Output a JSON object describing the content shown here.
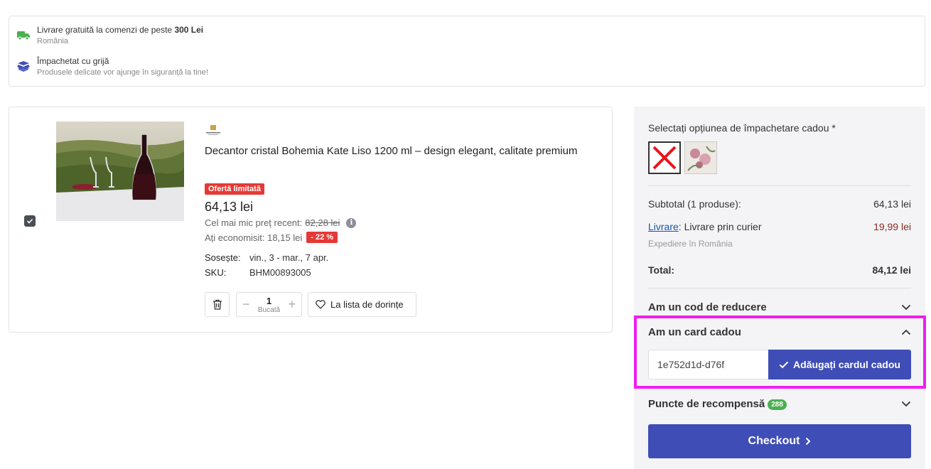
{
  "info": {
    "shipping_title_prefix": "Livrare gratuită la comenzi de peste ",
    "shipping_title_bold": "300 Lei",
    "shipping_sub": "România",
    "packing_title": "Împachetat cu grijă",
    "packing_sub": "Produsele delicate vor ajunge în siguranță la tine!"
  },
  "product": {
    "title": "Decantor cristal Bohemia Kate Liso 1200 ml – design elegant, calitate premium",
    "offer_badge": "Ofertă limitată",
    "price": "64,13 lei",
    "low_price_label": "Cel mai mic preț recent:",
    "low_price_value": "82,28 lei",
    "info_glyph": "i",
    "saved_label": "Ați economisit: 18,15 lei",
    "discount_badge": "- 22 %",
    "arrives_key": "Sosește:",
    "arrives_value": "vin., 3 - mar., 7 apr.",
    "sku_key": "SKU:",
    "sku_value": "BHM00893005",
    "quantity": "1",
    "quantity_unit": "Bucată",
    "wishlist_label": "La lista de dorințe",
    "selected": true
  },
  "sidebar": {
    "wrap_label": "Selectați opțiunea de împachetare cadou *",
    "subtotal_label": "Subtotal (1 produse):",
    "subtotal_value": "64,13 lei",
    "delivery_link": "Livrare",
    "delivery_label": ": Livrare prin curier",
    "delivery_value": "19,99 lei",
    "delivery_note": "Expediere în România",
    "total_label": "Total:",
    "total_value": "84,12 lei",
    "discount_code_title": "Am un cod de reducere",
    "gift_card_title": "Am un card cadou",
    "gift_card_value": "1e752d1d-d76f",
    "gift_card_button": "Adăugați cardul cadou",
    "points_title": "Puncte de recompensă",
    "points_badge": "288",
    "checkout_label": "Checkout"
  },
  "colors": {
    "accent": "#3f4db6",
    "highlight": "#f01ef0",
    "badge_red": "#e53935",
    "badge_green": "#4caf50"
  }
}
